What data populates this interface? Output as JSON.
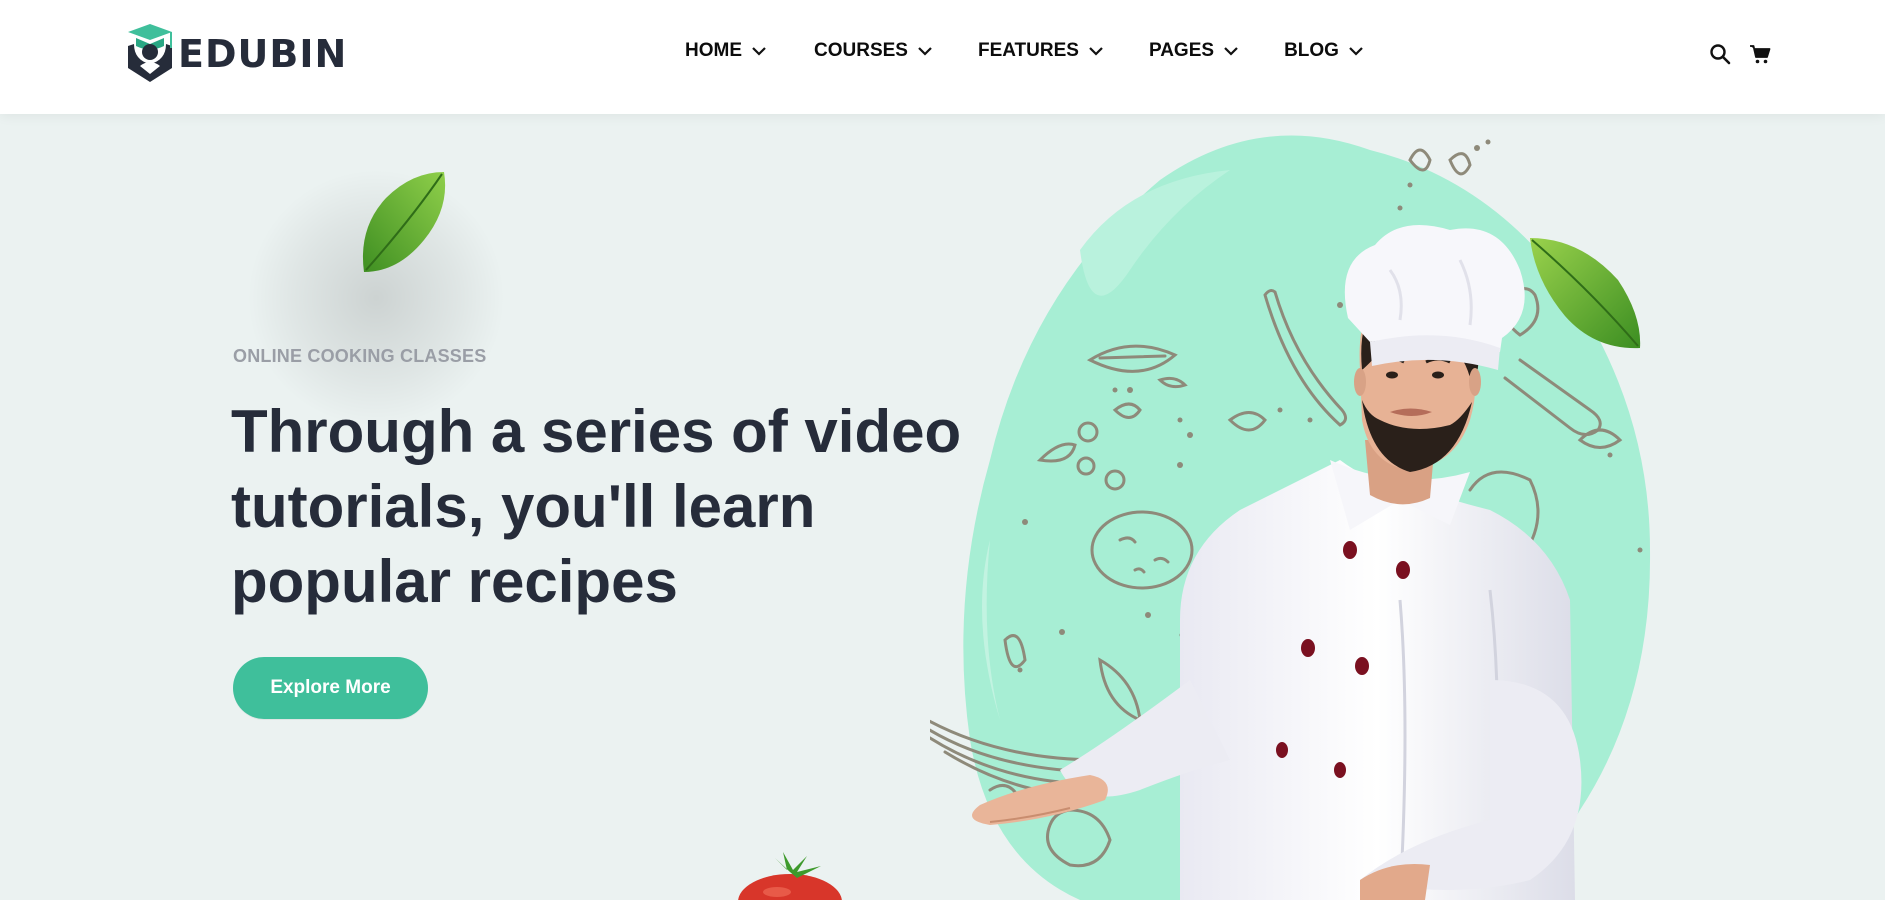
{
  "header": {
    "logo_text": "EDUBIN",
    "nav": [
      {
        "label": "HOME"
      },
      {
        "label": "COURSES"
      },
      {
        "label": "FEATURES"
      },
      {
        "label": "PAGES"
      },
      {
        "label": "BLOG"
      }
    ],
    "icons": [
      "search-icon",
      "cart-icon"
    ]
  },
  "hero": {
    "eyebrow": "ONLINE COOKING CLASSES",
    "headline_lines": [
      "Through a series of video",
      "tutorials, you'll learn",
      "popular recipes"
    ],
    "cta_label": "Explore More"
  },
  "colors": {
    "accent": "#3fbf9b",
    "background": "#ebf2f1",
    "text": "#262c3a",
    "splash": "#a7eed4"
  }
}
